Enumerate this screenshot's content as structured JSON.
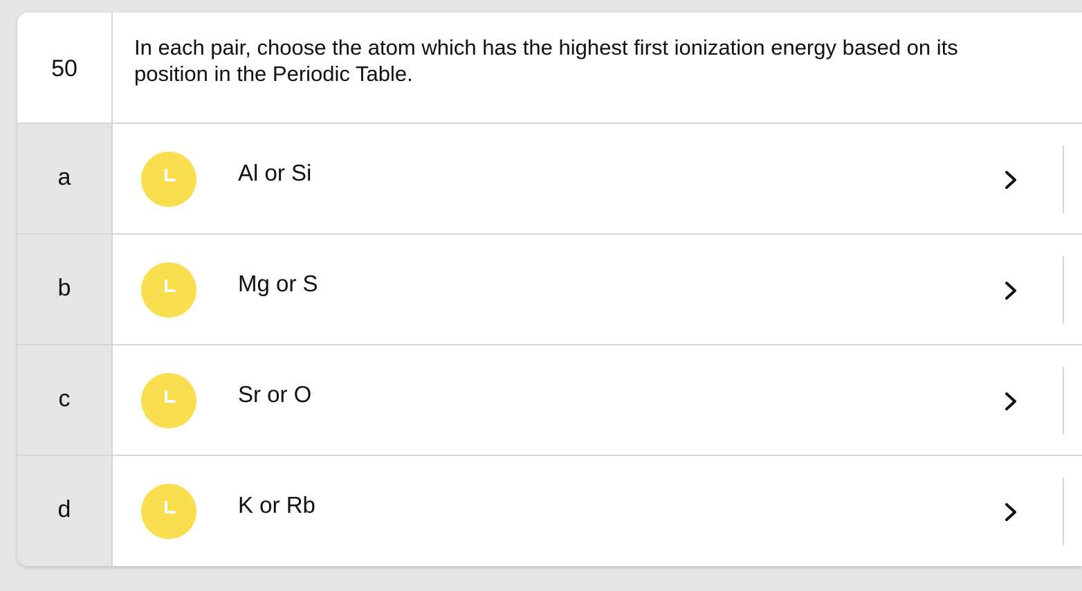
{
  "question": {
    "number": "50",
    "text": "In each pair, choose the atom which has the highest first ionization energy based on its position in the Periodic Table."
  },
  "items": [
    {
      "letter": "a",
      "text": "Al or Si",
      "status_icon": "clock-icon",
      "nav_icon": "chevron-right-icon"
    },
    {
      "letter": "b",
      "text": "Mg or S",
      "status_icon": "clock-icon",
      "nav_icon": "chevron-right-icon"
    },
    {
      "letter": "c",
      "text": "Sr or O",
      "status_icon": "clock-icon",
      "nav_icon": "chevron-right-icon"
    },
    {
      "letter": "d",
      "text": "K or Rb",
      "status_icon": "clock-icon",
      "nav_icon": "chevron-right-icon"
    }
  ],
  "colors": {
    "status_icon": "#f9df4f",
    "letter_column": "#e5e5e5",
    "background": "#e6e6e6"
  }
}
